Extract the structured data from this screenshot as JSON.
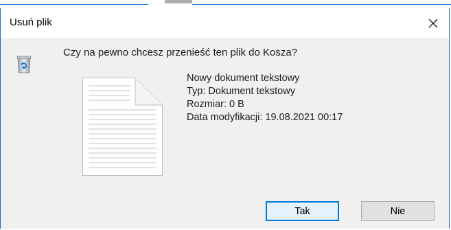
{
  "dialog": {
    "title": "Usuń plik",
    "close_icon": "close-icon",
    "question": "Czy na pewno chcesz przenieść ten plik do Kosza?",
    "recycle_icon": "recycle-bin-icon",
    "file_icon": "text-file-icon",
    "file": {
      "name": "Nowy dokument tekstowy",
      "type": "Typ: Dokument tekstowy",
      "size": "Rozmiar: 0 B",
      "modified": "Data modyfikacji: 19.08.2021 00:17"
    },
    "buttons": {
      "yes": "Tak",
      "no": "Nie"
    }
  },
  "colors": {
    "accent": "#0078d7",
    "window_border": "#1e6fd0",
    "dialog_background": "#f0f0f0"
  }
}
